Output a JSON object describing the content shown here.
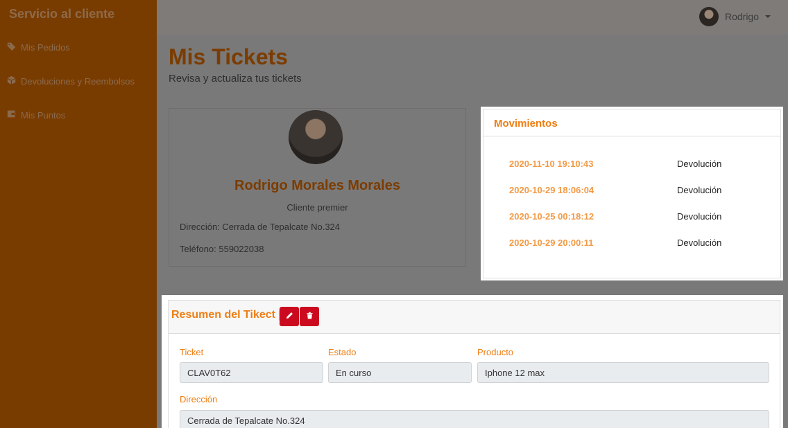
{
  "sidebar": {
    "brand": "Servicio al cliente",
    "items": [
      {
        "label": "Mis Pedidos",
        "icon": "tag-icon"
      },
      {
        "label": "Devoluciones y Reembolsos",
        "icon": "box-icon"
      },
      {
        "label": "Mis Puntos",
        "icon": "wallet-icon"
      }
    ]
  },
  "topbar": {
    "user_name": "Rodrigo"
  },
  "page": {
    "title": "Mis Tickets",
    "subtitle": "Revisa y actualiza tus tickets"
  },
  "profile": {
    "name": "Rodrigo Morales Morales",
    "role": "Cliente premier",
    "address": "Dirección: Cerrada de Tepalcate No.324",
    "phone": "Teléfono: 559022038"
  },
  "movimientos": {
    "title": "Movimientos",
    "rows": [
      {
        "date": "2020-11-10 19:10:43",
        "type": "Devolución"
      },
      {
        "date": "2020-10-29 18:06:04",
        "type": "Devolución"
      },
      {
        "date": "2020-10-25 00:18:12",
        "type": "Devolución"
      },
      {
        "date": "2020-10-29 20:00:11",
        "type": "Devolución"
      }
    ]
  },
  "resumen": {
    "title": "Resumen del Tikect |",
    "fields": {
      "ticket": {
        "label": "Ticket",
        "value": "CLAV0T62"
      },
      "estado": {
        "label": "Estado",
        "value": "En curso"
      },
      "producto": {
        "label": "Producto",
        "value": "Iphone 12 max"
      },
      "direccion": {
        "label": "Dirección",
        "value": "Cerrada de Tepalcate No.324"
      }
    }
  },
  "colors": {
    "sidebar": "#793c00",
    "accent": "#ee7d12",
    "danger": "#cc0a1f",
    "overlay_bg": "#7a7979"
  }
}
